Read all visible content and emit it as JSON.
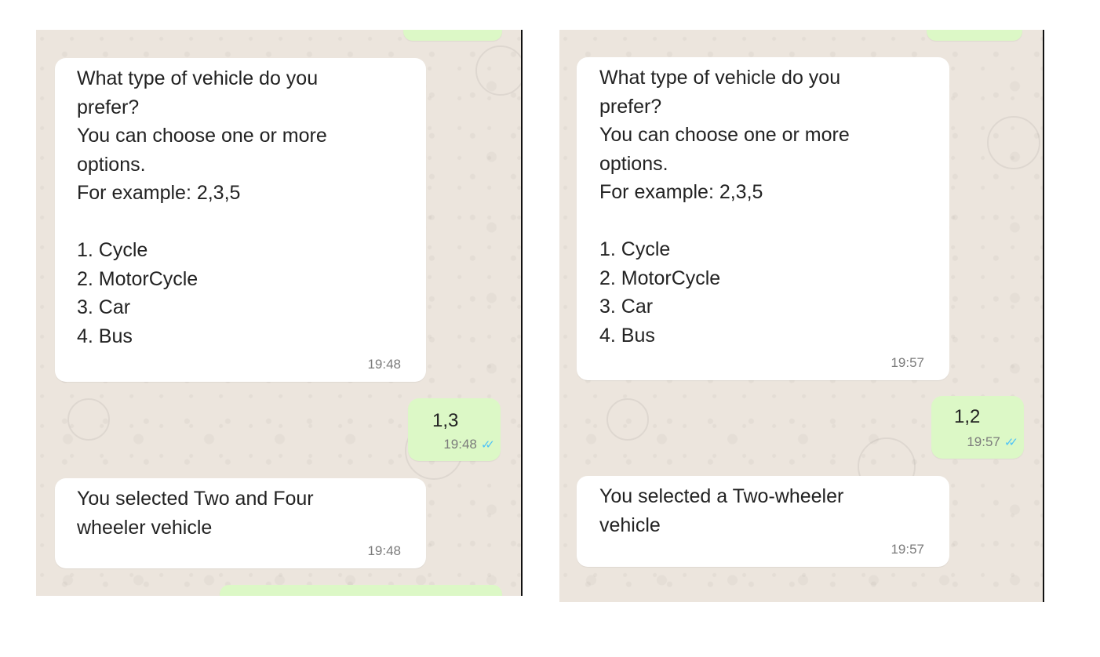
{
  "panels": [
    {
      "question": "What type of vehicle do you\nprefer?\nYou can choose one or more\noptions.\nFor example: 2,3,5\n\n1. Cycle\n2. MotorCycle\n3. Car\n4. Bus",
      "question_time": "19:48",
      "reply": "1,3",
      "reply_time": "19:48",
      "answer": "You selected Two and Four\nwheeler vehicle",
      "answer_time": "19:48"
    },
    {
      "question": "What type of vehicle do you\nprefer?\nYou can choose one or more\noptions.\nFor example: 2,3,5\n\n1. Cycle\n2. MotorCycle\n3. Car\n4. Bus",
      "question_time": "19:57",
      "reply": "1,2",
      "reply_time": "19:57",
      "answer": "You selected a Two-wheeler\nvehicle",
      "answer_time": "19:57"
    }
  ],
  "icons": {
    "read_receipt": "double-check-icon"
  },
  "colors": {
    "chat_bg": "#ece5dd",
    "incoming": "#ffffff",
    "outgoing": "#dcf8c6",
    "ticks": "#4fc3f7"
  }
}
